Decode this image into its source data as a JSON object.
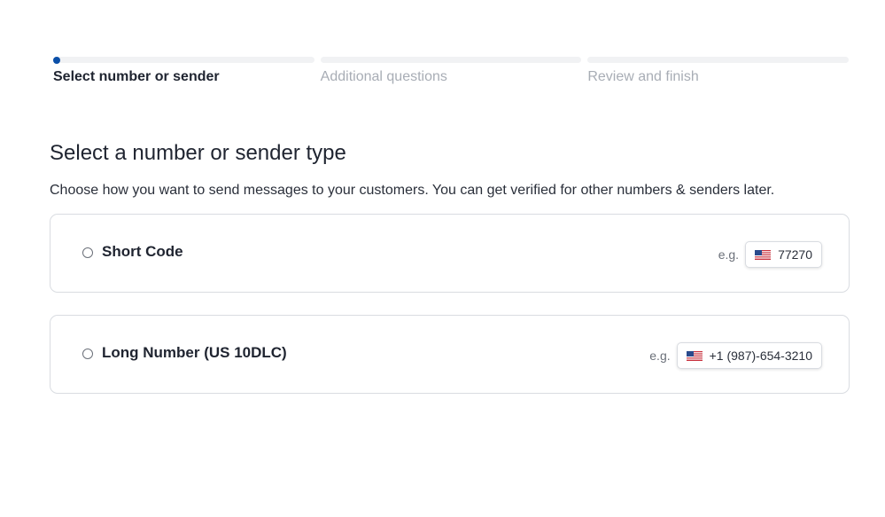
{
  "stepper": {
    "steps": [
      {
        "label": "Select number or sender",
        "state": "active"
      },
      {
        "label": "Additional questions",
        "state": "upcoming"
      },
      {
        "label": "Review and finish",
        "state": "upcoming"
      }
    ],
    "accent_color": "#0b4fa8"
  },
  "main": {
    "title": "Select a number or sender type",
    "description": "Choose how you want to send messages to your customers. You can get verified for other numbers & senders later."
  },
  "options": [
    {
      "label": "Short Code",
      "selected": false,
      "example_prefix": "e.g.",
      "example_flag": "us-flag-icon",
      "example_value": "77270"
    },
    {
      "label": "Long Number (US 10DLC)",
      "selected": false,
      "example_prefix": "e.g.",
      "example_flag": "us-flag-icon",
      "example_value": "+1 (987)-654-3210"
    }
  ]
}
